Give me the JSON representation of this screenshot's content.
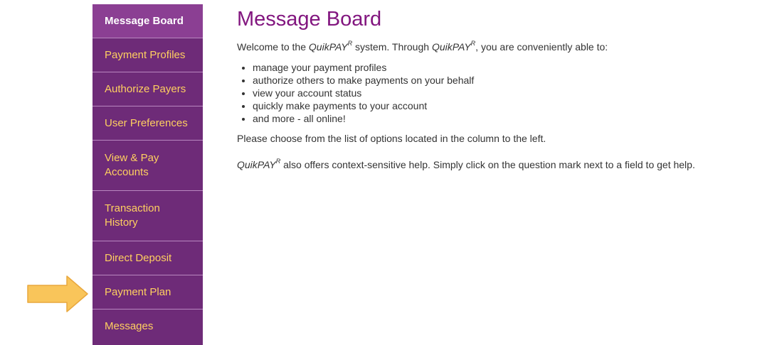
{
  "sidebar": {
    "items": [
      {
        "label": "Message Board"
      },
      {
        "label": "Payment Profiles"
      },
      {
        "label": "Authorize Payers"
      },
      {
        "label": "User Preferences"
      },
      {
        "label": "View & Pay Accounts"
      },
      {
        "label": "Transaction History"
      },
      {
        "label": "Direct Deposit"
      },
      {
        "label": "Payment Plan"
      },
      {
        "label": "Messages"
      }
    ],
    "active_item": "Message Board",
    "highlighted_item": "Payment Plan",
    "background_color": "#6e2b78",
    "link_color": "#ffd060"
  },
  "pointer_arrow": {
    "icon": "right-arrow-icon",
    "color": "#f9c55a"
  },
  "main": {
    "title": "Message Board",
    "title_color": "#82167f",
    "brand": "QuikPAY",
    "brand_sup": "R",
    "intro": {
      "part1": "Welcome to the ",
      "part2": " system. Through ",
      "part3": ", you are conveniently able to:"
    },
    "features": [
      "manage your payment profiles",
      "authorize others to make payments on your behalf",
      "view your account status",
      "quickly make payments to your account",
      "and more - all online!"
    ],
    "choose_text": "Please choose from the list of options located in the column to the left.",
    "help_text": " also offers context-sensitive help. Simply click on the question mark next to a field to get help."
  }
}
